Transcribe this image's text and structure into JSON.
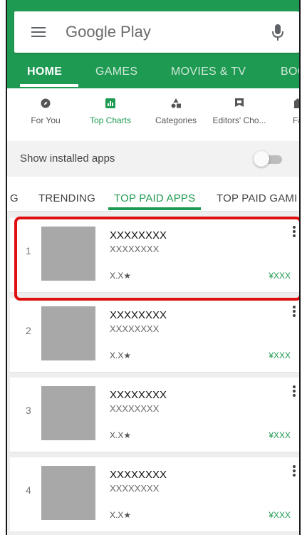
{
  "search": {
    "title": "Google Play"
  },
  "nav_tabs": [
    {
      "label": "HOME",
      "active": true
    },
    {
      "label": "GAMES",
      "active": false
    },
    {
      "label": "MOVIES & TV",
      "active": false
    },
    {
      "label": "BOO",
      "active": false
    }
  ],
  "sub_tabs": [
    {
      "label": "For You",
      "icon": "compass-icon",
      "active": false
    },
    {
      "label": "Top Charts",
      "icon": "chart-icon",
      "active": true
    },
    {
      "label": "Categories",
      "icon": "categories-icon",
      "active": false
    },
    {
      "label": "Editors' Cho...",
      "icon": "editors-choice-icon",
      "active": false
    },
    {
      "label": "Fa",
      "icon": "family-icon",
      "active": false
    }
  ],
  "installed_toggle": {
    "label": "Show installed apps",
    "on": false
  },
  "chart_tabs": [
    {
      "label": "G",
      "active": false
    },
    {
      "label": "TRENDING",
      "active": false
    },
    {
      "label": "TOP PAID APPS",
      "active": true
    },
    {
      "label": "TOP PAID GAMI",
      "active": false
    }
  ],
  "apps": [
    {
      "rank": "1",
      "name": "XXXXXXXX",
      "developer": "XXXXXXXX",
      "rating": "X.X★",
      "price": "¥XXX",
      "highlighted": true
    },
    {
      "rank": "2",
      "name": "XXXXXXXX",
      "developer": "XXXXXXXX",
      "rating": "X.X★",
      "price": "¥XXX",
      "highlighted": false
    },
    {
      "rank": "3",
      "name": "XXXXXXXX",
      "developer": "XXXXXXXX",
      "rating": "X.X★",
      "price": "¥XXX",
      "highlighted": false
    },
    {
      "rank": "4",
      "name": "XXXXXXXX",
      "developer": "XXXXXXXX",
      "rating": "X.X★",
      "price": "¥XXX",
      "highlighted": false
    }
  ],
  "colors": {
    "brand_green": "#1f9a52",
    "highlight_red": "#e01010"
  }
}
